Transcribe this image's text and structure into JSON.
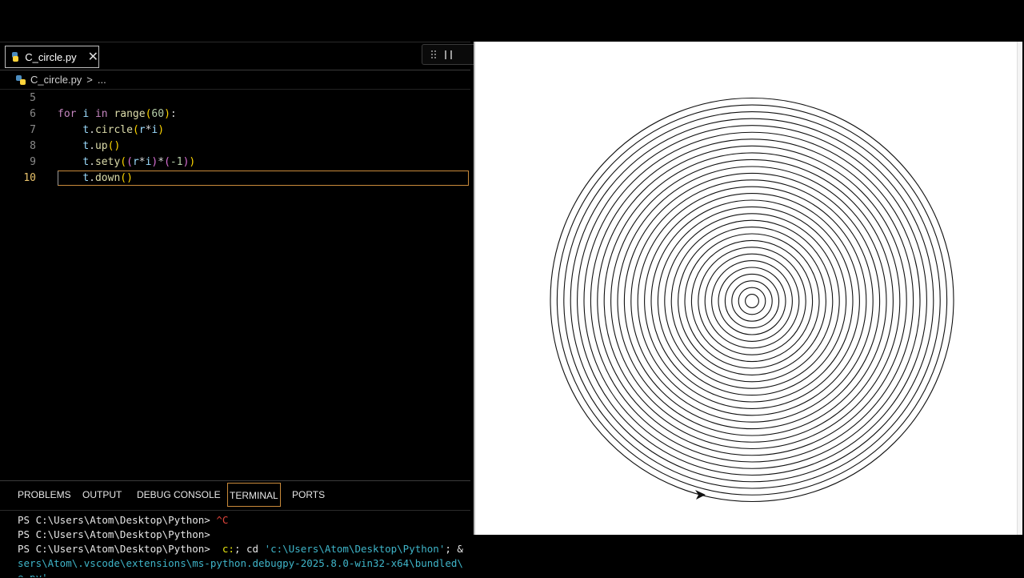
{
  "editor": {
    "tab": {
      "filename": "C_circle.py",
      "close": "✕"
    },
    "breadcrumb": {
      "file": "C_circle.py",
      "sep": ">",
      "more": "..."
    },
    "lines": [
      {
        "num": "5",
        "tokens": []
      },
      {
        "num": "6",
        "tokens": [
          {
            "t": "for",
            "c": "kw"
          },
          {
            "t": " "
          },
          {
            "t": "i",
            "c": "var"
          },
          {
            "t": " "
          },
          {
            "t": "in",
            "c": "kw"
          },
          {
            "t": " "
          },
          {
            "t": "range",
            "c": "fn"
          },
          {
            "t": "(",
            "c": "par"
          },
          {
            "t": "60",
            "c": "num"
          },
          {
            "t": ")",
            "c": "par"
          },
          {
            "t": ":"
          }
        ]
      },
      {
        "num": "7",
        "tokens": [
          {
            "t": "    "
          },
          {
            "t": "t",
            "c": "var"
          },
          {
            "t": "."
          },
          {
            "t": "circle",
            "c": "fn"
          },
          {
            "t": "(",
            "c": "par"
          },
          {
            "t": "r",
            "c": "var"
          },
          {
            "t": "*"
          },
          {
            "t": "i",
            "c": "var"
          },
          {
            "t": ")",
            "c": "par"
          }
        ]
      },
      {
        "num": "8",
        "tokens": [
          {
            "t": "    "
          },
          {
            "t": "t",
            "c": "var"
          },
          {
            "t": "."
          },
          {
            "t": "up",
            "c": "fn"
          },
          {
            "t": "()",
            "c": "par"
          }
        ]
      },
      {
        "num": "9",
        "tokens": [
          {
            "t": "    "
          },
          {
            "t": "t",
            "c": "var"
          },
          {
            "t": "."
          },
          {
            "t": "sety",
            "c": "fn"
          },
          {
            "t": "(",
            "c": "par"
          },
          {
            "t": "(",
            "c": "par2"
          },
          {
            "t": "r",
            "c": "var"
          },
          {
            "t": "*"
          },
          {
            "t": "i",
            "c": "var"
          },
          {
            "t": ")",
            "c": "par2"
          },
          {
            "t": "*"
          },
          {
            "t": "(",
            "c": "par2"
          },
          {
            "t": "-1",
            "c": "num"
          },
          {
            "t": ")",
            "c": "par2"
          },
          {
            "t": ")",
            "c": "par"
          }
        ]
      },
      {
        "num": "10",
        "tokens": [
          {
            "t": "    "
          },
          {
            "t": "t",
            "c": "var"
          },
          {
            "t": "."
          },
          {
            "t": "down",
            "c": "fn"
          },
          {
            "t": "()",
            "c": "par"
          }
        ],
        "current": true
      }
    ]
  },
  "panel": {
    "tabs": [
      "PROBLEMS",
      "OUTPUT",
      "DEBUG CONSOLE",
      "TERMINAL",
      "PORTS"
    ],
    "active_tab": "TERMINAL",
    "terminal": {
      "line1_prompt": "PS C:\\Users\\Atom\\Desktop\\Python> ",
      "line1_cmd": "^C",
      "line2_prompt": "PS C:\\Users\\Atom\\Desktop\\Python>",
      "line3_prompt": "PS C:\\Users\\Atom\\Desktop\\Python> ",
      "line3_cmd_a": " c:",
      "line3_cmd_b": "; cd ",
      "line3_cmd_c": "'c:\\Users\\Atom\\Desktop\\Python'",
      "line3_cmd_d": "; &",
      "line4": "sers\\Atom\\.vscode\\extensions\\ms-python.debugpy-2025.8.0-win32-x64\\bundled\\",
      "line5": "e.py'"
    }
  },
  "colors": {
    "keyword": "#c586c0",
    "function": "#dcdcaa",
    "variable": "#9cdcfe",
    "number": "#b5cea8",
    "active_border": "#c98a3b"
  }
}
